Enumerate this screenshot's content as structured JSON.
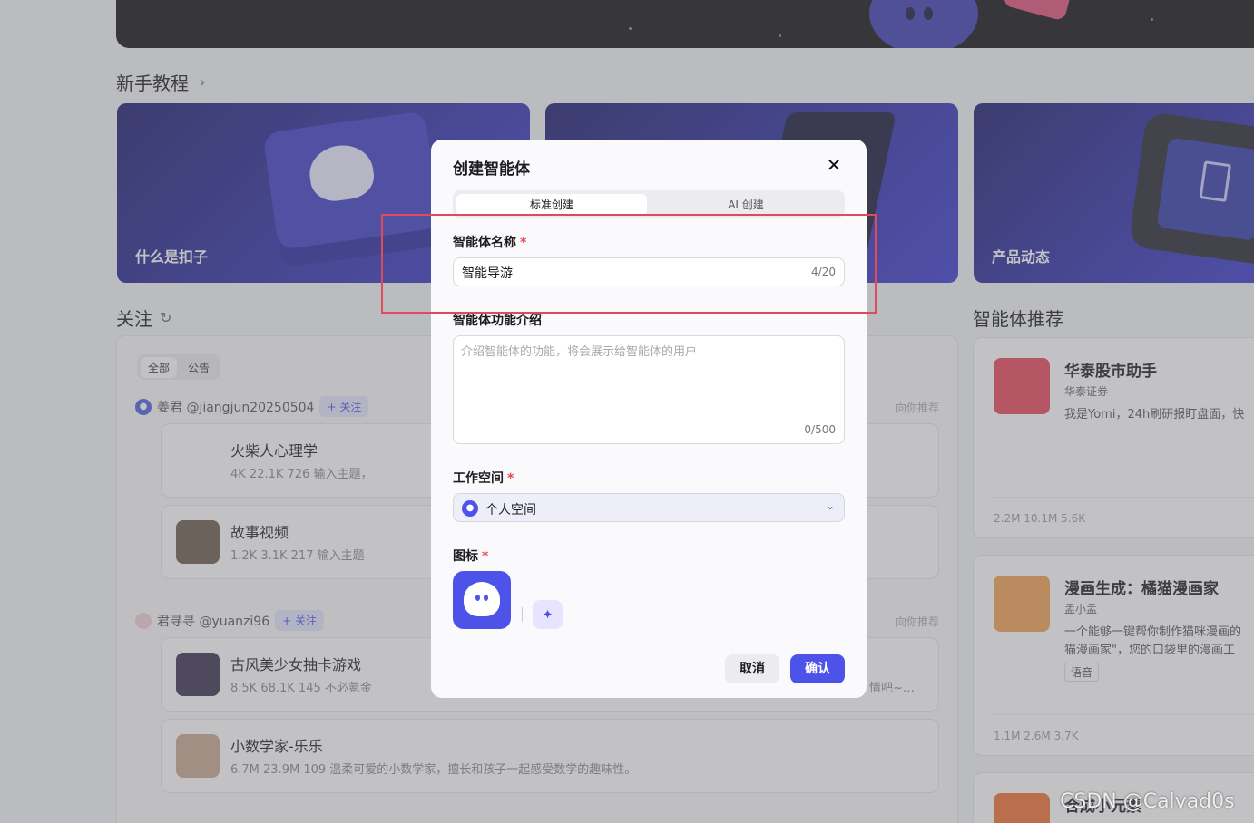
{
  "tutorial": {
    "title": "新手教程",
    "cards": [
      "什么是扣子",
      "",
      "产品动态"
    ]
  },
  "follow": {
    "title": "关注",
    "filters": [
      "全部",
      "公告"
    ],
    "follow_label": "+ 关注",
    "recommend_label": "向你推荐",
    "groups": [
      {
        "user": "姜君 @jiangjun20250504",
        "bots": [
          {
            "name": "火柴人心理学",
            "stats": "4K   22.1K   726   输入主题，"
          },
          {
            "name": "故事视频",
            "stats": "1.2K   3.1K   217   输入主题"
          }
        ]
      },
      {
        "user": "君寻寻 @yuanzi96",
        "bots": [
          {
            "name": "古风美少女抽卡游戏",
            "stats": "8.5K   68.1K   145   不必氪金",
            "tail": "情吧~…"
          },
          {
            "name": "小数学家-乐乐",
            "stats": "6.7M   23.9M   109   温柔可爱的小数学家，擅长和孩子一起感受数学的趣味性。"
          }
        ]
      }
    ]
  },
  "recommend": {
    "title": "智能体推荐",
    "cards": [
      {
        "title": "华泰股市助手",
        "sub": "华泰证券",
        "desc": "我是Yomi，24h刷研报盯盘面，快",
        "stats": "2.2M    10.1M    5.6K"
      },
      {
        "title": "漫画生成：橘猫漫画家",
        "sub": "孟小孟",
        "desc": "一个能够一键帮你制作猫咪漫画的\n猫漫画家\"，您的口袋里的漫画工",
        "tag": "语音",
        "stats": "1.1M    2.6M    3.7K"
      },
      {
        "title": "合成小元素",
        "sub": "",
        "desc": "",
        "stats": ""
      }
    ]
  },
  "modal": {
    "title": "创建智能体",
    "close_icon": "close-icon",
    "tabs": [
      "标准创建",
      "AI 创建"
    ],
    "name_label": "智能体名称",
    "name_value": "智能导游",
    "name_count": "4/20",
    "desc_label": "智能体功能介绍",
    "desc_placeholder": "介绍智能体的功能，将会展示给智能体的用户",
    "desc_count": "0/500",
    "workspace_label": "工作空间",
    "workspace_value": "个人空间",
    "icon_label": "图标",
    "required_mark": "*",
    "cancel_label": "取消",
    "confirm_label": "确认",
    "accent_color": "#4d53e8"
  },
  "watermark": "CSDN @Calvad0s"
}
